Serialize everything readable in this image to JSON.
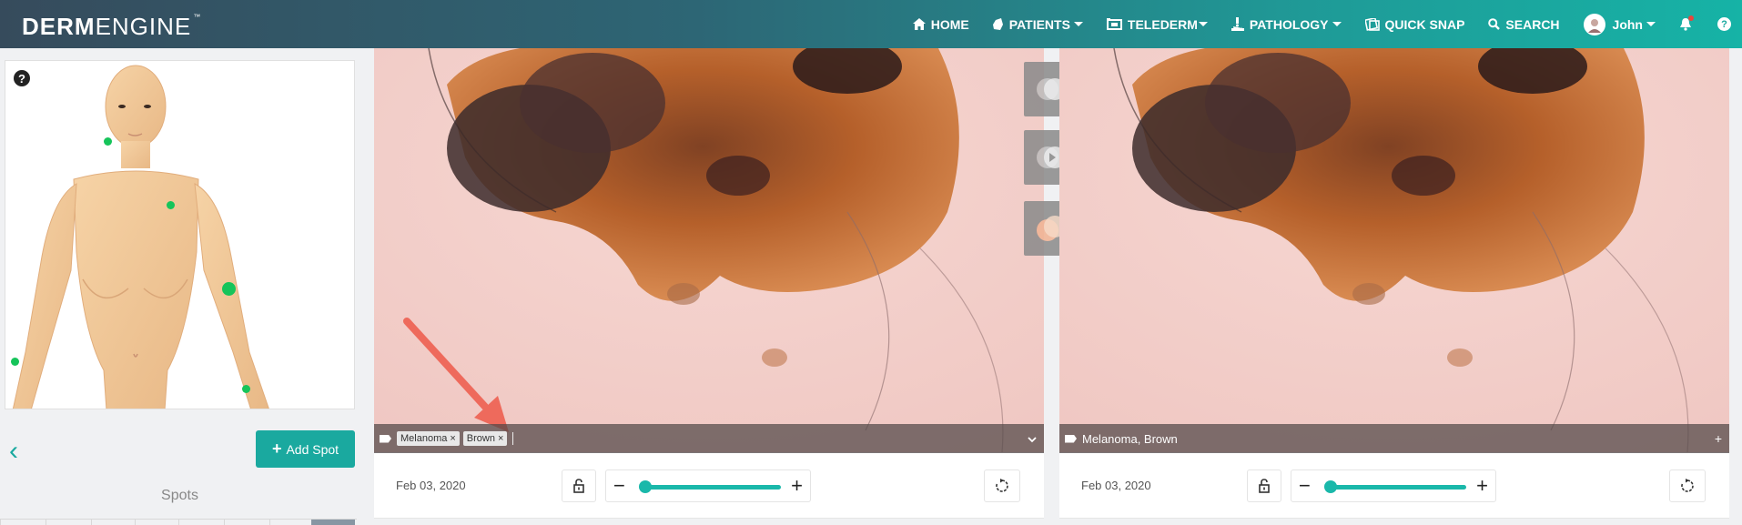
{
  "header": {
    "brand_bold": "DERM",
    "brand_light": "ENGINE",
    "brand_tm": "™",
    "nav": {
      "home": "HOME",
      "patients": "PATIENTS",
      "telederm": "TELEDERM",
      "pathology": "PATHOLOGY",
      "quick_snap": "QUICK SNAP",
      "search": "SEARCH",
      "user": "John"
    },
    "help_glyph": "?",
    "brand_color": "#1aa99f"
  },
  "left": {
    "map_help_glyph": "?",
    "back_glyph": "‹",
    "add_spot_plus": "+",
    "add_spot_label": "Add Spot",
    "spots_title": "Spots"
  },
  "left_image": {
    "tags": [
      {
        "label": "Melanoma",
        "remove": "×"
      },
      {
        "label": "Brown",
        "remove": "×"
      }
    ],
    "date": "Feb 03, 2020",
    "zoom_minus": "−",
    "zoom_plus": "+",
    "zoom_level": 0
  },
  "right_image": {
    "tags_text": "Melanoma, Brown",
    "tag_action": "+",
    "date": "Feb 03, 2020",
    "zoom_minus": "−",
    "zoom_plus": "+",
    "zoom_level": 0
  },
  "icons": {
    "home": "home-icon",
    "patients": "patients-icon",
    "telederm": "telederm-icon",
    "pathology": "microscope-icon",
    "quick_snap": "camera-icon",
    "search": "search-icon",
    "notifications": "bell-icon",
    "lock": "lock-icon",
    "rotate": "rotate-icon",
    "tag": "tag-icon"
  }
}
